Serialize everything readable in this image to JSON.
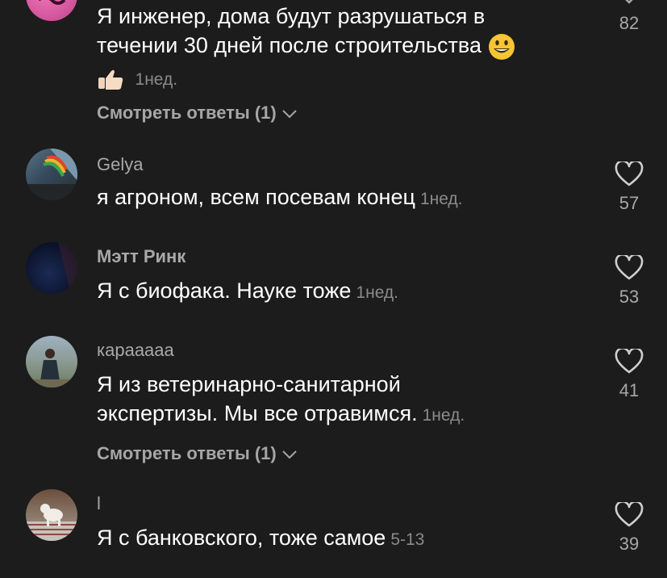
{
  "comments": [
    {
      "text_line1": "Я инженер, дома будут разрушаться в",
      "text_line2": "течении 30 дней после строительства",
      "time": "1нед.",
      "likes": "82",
      "replies_label": "Смотреть ответы (1)",
      "emoji": [
        "grinning-face",
        "thumbs-up"
      ]
    },
    {
      "username": "Gelya",
      "text": "я агроном, всем посевам конец",
      "time": "1нед.",
      "likes": "57"
    },
    {
      "username": "Мэтт Ринк",
      "text": "Я с биофака. Науке тоже",
      "time": "1нед.",
      "likes": "53"
    },
    {
      "username": "карааааа",
      "text_line1": "Я из ветеринарно-санитарной",
      "text_line2": "экспертизы. Мы все отравимся.",
      "time": "1нед.",
      "likes": "41",
      "replies_label": "Смотреть ответы (1)"
    },
    {
      "username": "l",
      "text": "Я с банковского, тоже самое",
      "time": "5-13",
      "likes": "39"
    }
  ],
  "colors": {
    "background": "#1c1c1c",
    "text": "#ffffff",
    "secondary": "#a8a8a8"
  }
}
